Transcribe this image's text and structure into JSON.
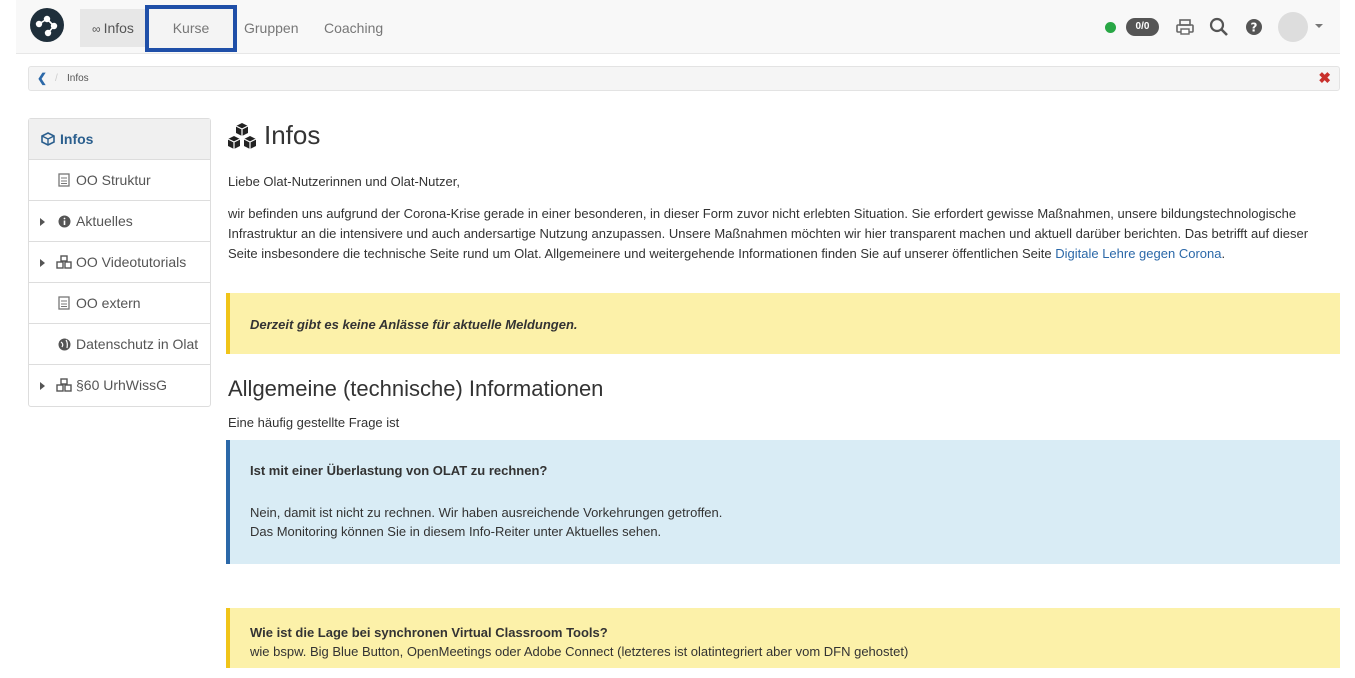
{
  "nav": {
    "infos_prefix": "∞",
    "infos": "Infos",
    "kurse": "Kurse",
    "gruppen": "Gruppen",
    "coaching": "Coaching"
  },
  "toolbar": {
    "status_color": "#28a745",
    "badge": "0/0",
    "icons": [
      "print-icon",
      "search-icon",
      "help-icon",
      "avatar",
      "chevron-down-icon"
    ]
  },
  "breadcrumb": {
    "back_icon": "chevron-left-icon",
    "separator": "/",
    "current": "Infos",
    "close_icon": "close-icon"
  },
  "sidebar": {
    "items": [
      {
        "label": "Infos",
        "icon": "cube-icon",
        "active": true
      },
      {
        "label": "OO Struktur",
        "icon": "document-icon"
      },
      {
        "label": "Aktuelles",
        "icon": "info-icon",
        "expandable": true
      },
      {
        "label": "OO Videotutorials",
        "icon": "cubes-icon",
        "expandable": true
      },
      {
        "label": "OO extern",
        "icon": "document-icon"
      },
      {
        "label": "Datenschutz in Olat",
        "icon": "globe-icon"
      },
      {
        "label": "§60 UrhWissG",
        "icon": "cubes-icon",
        "expandable": true
      }
    ]
  },
  "main": {
    "title": "Infos",
    "greeting": "Liebe Olat-Nutzerinnen und Olat-Nutzer,",
    "paragraph": "wir befinden uns aufgrund der Corona-Krise gerade in einer besonderen, in dieser Form zuvor nicht erlebten Situation. Sie erfordert gewisse Maßnahmen, unsere bildungstechnologische Infrastruktur an die intensivere und auch andersartige Nutzung anzupassen. Unsere Maßnahmen möchten wir hier transparent machen und aktuell darüber berichten. Das betrifft auf dieser Seite insbesondere die technische Seite rund um Olat. Allgemeinere und weitergehende Informationen finden Sie auf unserer öffentlichen Seite ",
    "paragraph_link": "Digitale Lehre gegen Corona",
    "paragraph_end": ".",
    "notice": "Derzeit gibt es keine Anlässe für aktuelle Meldungen.",
    "section_title": "Allgemeine (technische) Informationen",
    "section_sub": "Eine häufig gestellte Frage ist",
    "faq1": {
      "question": "Ist mit einer Überlastung von OLAT zu rechnen?",
      "line1": "Nein, damit ist nicht zu rechnen. Wir haben ausreichende Vorkehrungen getroffen.",
      "line2": "Das Monitoring können Sie in diesem Info-Reiter unter Aktuelles sehen."
    },
    "faq2": {
      "question": "Wie ist die Lage bei synchronen Virtual Classroom Tools?",
      "line1": "wie bspw. Big Blue Button, OpenMeetings oder Adobe Connect (letzteres ist olatintegriert aber vom DFN gehostet)"
    }
  }
}
